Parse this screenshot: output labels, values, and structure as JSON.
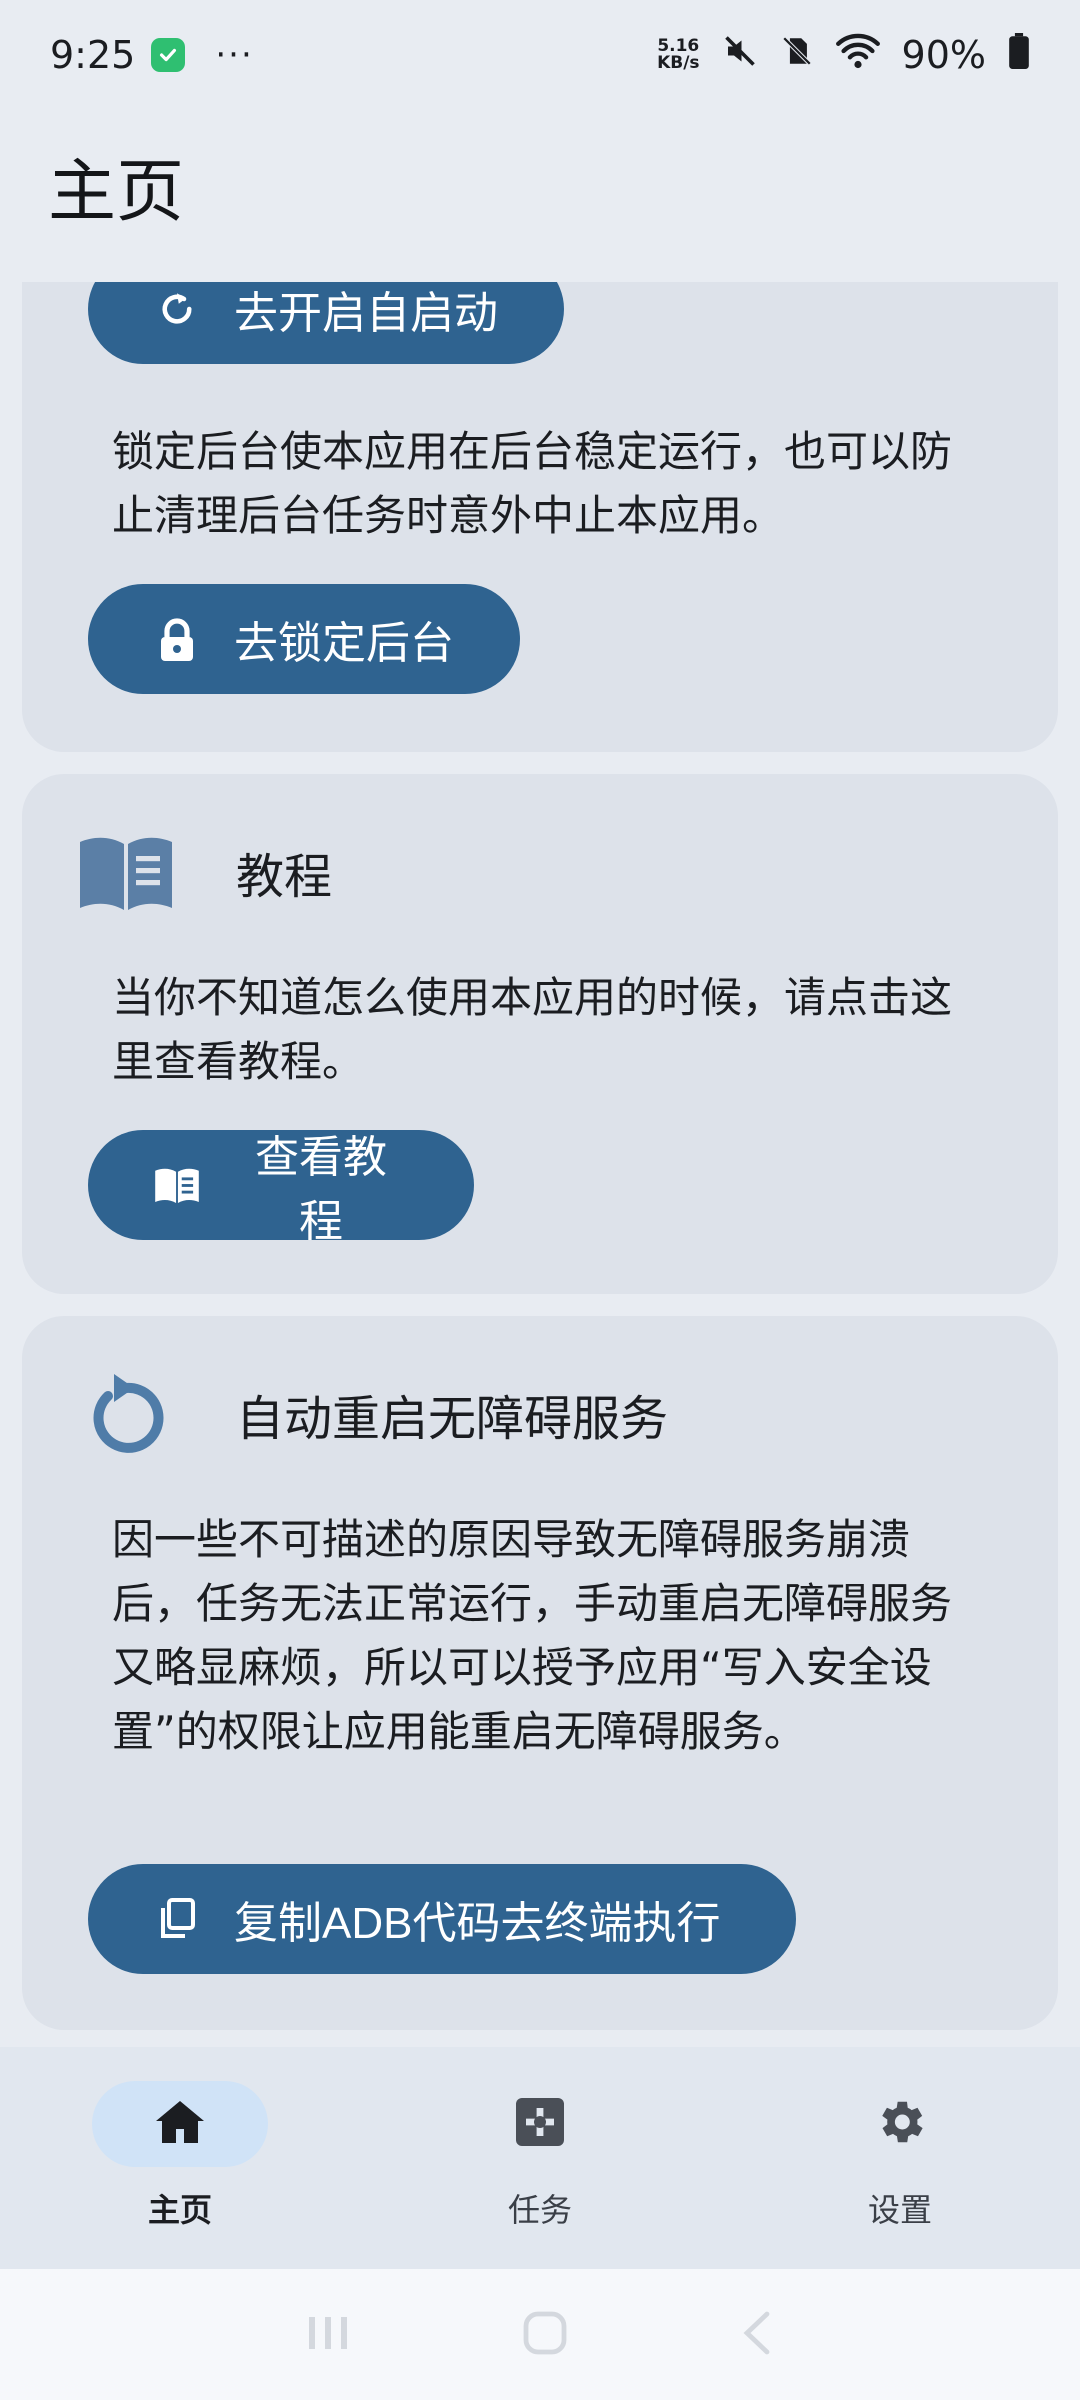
{
  "status_bar": {
    "time": "9:25",
    "net_speed_top": "5.16",
    "net_speed_bottom": "KB/s",
    "battery": "90%"
  },
  "app_bar": {
    "title": "主页"
  },
  "cards": {
    "autostart": {
      "button_label": "去开启自启动"
    },
    "lock": {
      "description": "锁定后台使本应用在后台稳定运行，也可以防止清理后台任务时意外中止本应用。",
      "button_label": "去锁定后台"
    },
    "tutorial": {
      "title": "教程",
      "description": "当你不知道怎么使用本应用的时候，请点击这里查看教程。",
      "button_label": "查看教程"
    },
    "restart": {
      "title": "自动重启无障碍服务",
      "description": "因一些不可描述的原因导致无障碍服务崩溃后，任务无法正常运行，手动重启无障碍服务又略显麻烦，所以可以授予应用“写入安全设置”的权限让应用能重启无障碍服务。",
      "button_label": "复制ADB代码去终端执行"
    }
  },
  "bottom_nav": {
    "items": [
      {
        "label": "主页",
        "icon": "home-icon",
        "active": true
      },
      {
        "label": "任务",
        "icon": "puzzle-icon",
        "active": false
      },
      {
        "label": "设置",
        "icon": "gear-icon",
        "active": false
      }
    ]
  },
  "colors": {
    "accent": "#2f6390",
    "card": "#dde2ea",
    "background": "#e8ecf2",
    "nav_active": "#d0e3f7"
  }
}
